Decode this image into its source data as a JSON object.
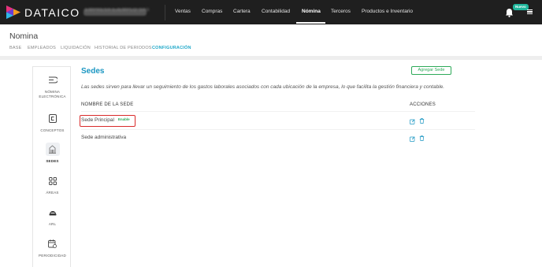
{
  "colors": {
    "nav_bg": "#1f1f1f",
    "accent_blue": "#1a96c2",
    "accent_teal": "#1fa8c9",
    "green": "#2eaa59",
    "highlight_red": "#d92b2b"
  },
  "app": {
    "brand": "DATAICO",
    "company_name": "EMPRESA EJEMPLO SAS",
    "logo_icon": "dataico-logo-icon"
  },
  "nav": {
    "items": [
      "Ventas",
      "Compras",
      "Cartera",
      "Contabilidad",
      "Nómina",
      "Terceros",
      "Productos e Inventario"
    ],
    "active": "Nómina",
    "notification_badge": "Nuevo"
  },
  "page": {
    "title": "Nomina",
    "subtabs": [
      "BASE",
      "EMPLEADOS",
      "LIQUIDACIÓN",
      "HISTORIAL DE PERIODOS",
      "CONFIGURACIÓN"
    ],
    "active_subtab": "CONFIGURACIÓN"
  },
  "config_menu": [
    {
      "label": "NÓMINA ELECTRÓNICA",
      "icon": "electronic-payroll-icon"
    },
    {
      "label": "CONCEPTOS",
      "icon": "concepts-icon"
    },
    {
      "label": "SEDES",
      "icon": "building-icon",
      "active": true
    },
    {
      "label": "ÁREAS",
      "icon": "grid-icon"
    },
    {
      "label": "ARL",
      "icon": "helmet-icon"
    },
    {
      "label": "PERIODICIDAD",
      "icon": "calendar-icon"
    }
  ],
  "sedes": {
    "title": "Sedes",
    "add_button": "Agregar Sede",
    "description": "Las sedes sirven para llevar un seguimiento de los gastos laborales asociados con cada ubicación de la empresa, lo que facilita la gestión financiera y contable.",
    "columns": {
      "name": "NOMBRE DE LA SEDE",
      "actions": "ACCIONES"
    },
    "rows": [
      {
        "name": "Sede Principal",
        "badge": "Enable"
      },
      {
        "name": "Sede administrativa",
        "badge": ""
      }
    ]
  }
}
